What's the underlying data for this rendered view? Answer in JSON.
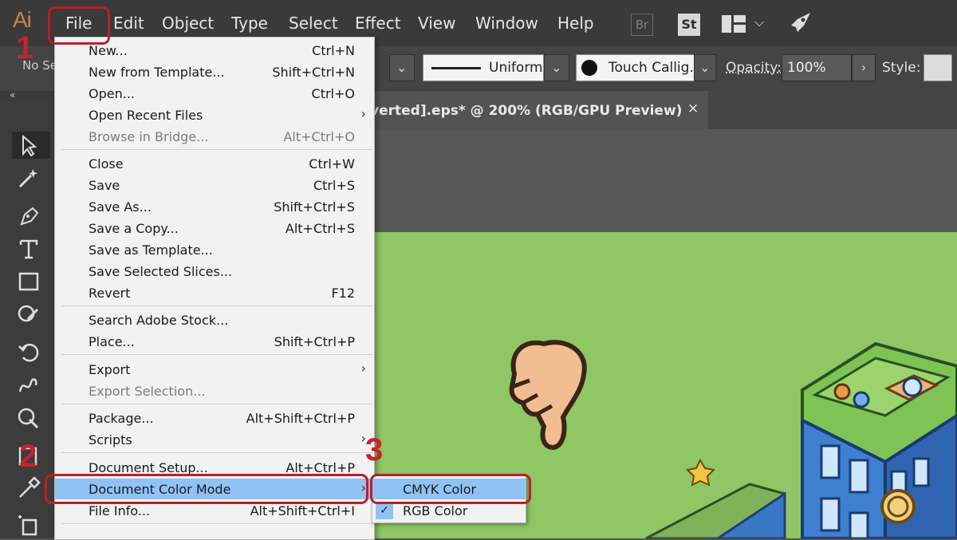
{
  "app": {
    "logo": "Ai"
  },
  "menubar": {
    "items": [
      "File",
      "Edit",
      "Object",
      "Type",
      "Select",
      "Effect",
      "View",
      "Window",
      "Help"
    ],
    "bridge_label": "Br",
    "stock_label": "St"
  },
  "control_bar": {
    "selection_text": "No Se",
    "stroke_profile": "Uniform",
    "brush": "Touch Callig...",
    "opacity_label": "Opacity:",
    "opacity_value": "100%",
    "style_label": "Style:"
  },
  "document_tab": {
    "title": "verted].eps* @ 200% (RGB/GPU Preview)",
    "close": "×"
  },
  "file_menu": {
    "items": [
      {
        "label": "New...",
        "shortcut": "Ctrl+N"
      },
      {
        "label": "New from Template...",
        "shortcut": "Shift+Ctrl+N"
      },
      {
        "label": "Open...",
        "shortcut": "Ctrl+O"
      },
      {
        "label": "Open Recent Files",
        "shortcut": ""
      },
      {
        "label": "Browse in Bridge...",
        "shortcut": "Alt+Ctrl+O"
      },
      {
        "label": "Close",
        "shortcut": "Ctrl+W"
      },
      {
        "label": "Save",
        "shortcut": "Ctrl+S"
      },
      {
        "label": "Save As...",
        "shortcut": "Shift+Ctrl+S"
      },
      {
        "label": "Save a Copy...",
        "shortcut": "Alt+Ctrl+S"
      },
      {
        "label": "Save as Template...",
        "shortcut": ""
      },
      {
        "label": "Save Selected Slices...",
        "shortcut": ""
      },
      {
        "label": "Revert",
        "shortcut": "F12"
      },
      {
        "label": "Search Adobe Stock...",
        "shortcut": ""
      },
      {
        "label": "Place...",
        "shortcut": "Shift+Ctrl+P"
      },
      {
        "label": "Export",
        "shortcut": ""
      },
      {
        "label": "Export Selection...",
        "shortcut": ""
      },
      {
        "label": "Package...",
        "shortcut": "Alt+Shift+Ctrl+P"
      },
      {
        "label": "Scripts",
        "shortcut": ""
      },
      {
        "label": "Document Setup...",
        "shortcut": "Alt+Ctrl+P"
      },
      {
        "label": "Document Color Mode",
        "shortcut": ""
      },
      {
        "label": "File Info...",
        "shortcut": "Alt+Shift+Ctrl+I"
      }
    ]
  },
  "color_mode_submenu": {
    "items": [
      "CMYK Color",
      "RGB Color"
    ],
    "checked": "RGB Color"
  },
  "annotations": {
    "step1": "1",
    "step2": "2",
    "step3": "3"
  },
  "colors": {
    "highlight": "#91c2f4",
    "callout": "#b8202a",
    "artboard": "#8ec764",
    "logo": "#c6864f"
  },
  "icons": [
    "chevron-down-icon",
    "workspace-layout-icon",
    "rocket-icon",
    "selection-tool-icon",
    "magic-wand-icon",
    "pen-tool-icon",
    "type-tool-icon",
    "rectangle-tool-icon",
    "pencil-tool-icon",
    "rotate-tool-icon",
    "warp-tool-icon",
    "free-transform-icon",
    "graph-tool-icon",
    "eyedropper-icon",
    "artboard-tool-icon",
    "checkmark-icon",
    "submenu-arrow-icon",
    "close-icon"
  ]
}
